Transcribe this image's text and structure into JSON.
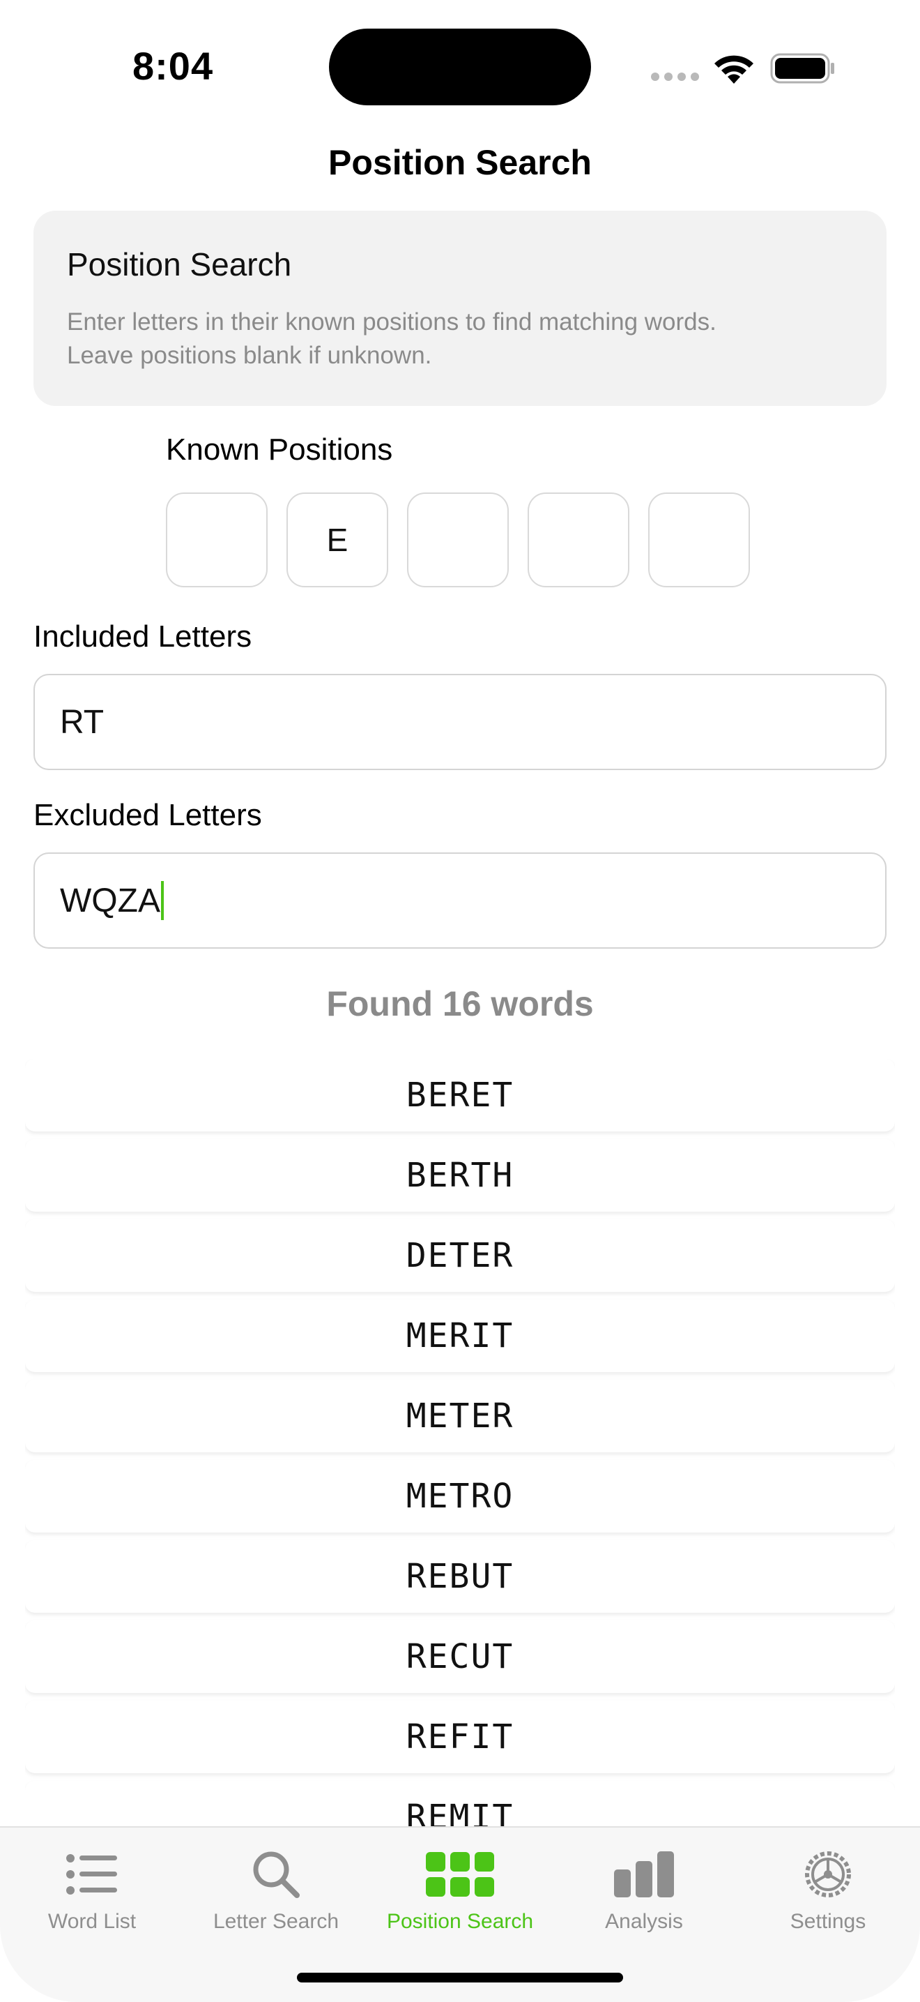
{
  "status_bar": {
    "time": "8:04"
  },
  "nav": {
    "title": "Position Search"
  },
  "info": {
    "title": "Position Search",
    "description": "Enter letters in their known positions to find matching words.\nLeave positions blank if unknown."
  },
  "known_positions": {
    "label": "Known Positions",
    "values": [
      "",
      "E",
      "",
      "",
      ""
    ]
  },
  "included": {
    "label": "Included Letters",
    "value": "RT"
  },
  "excluded": {
    "label": "Excluded Letters",
    "value": "WQZA"
  },
  "results": {
    "summary": "Found 16 words",
    "words": [
      "BERET",
      "BERTH",
      "DETER",
      "MERIT",
      "METER",
      "METRO",
      "REBUT",
      "RECUT",
      "REFIT",
      "REMIT"
    ]
  },
  "tabs": [
    {
      "label": "Word List",
      "icon": "list-icon"
    },
    {
      "label": "Letter Search",
      "icon": "search-icon"
    },
    {
      "label": "Position Search",
      "icon": "grid-icon"
    },
    {
      "label": "Analysis",
      "icon": "bar-chart-icon"
    },
    {
      "label": "Settings",
      "icon": "gear-icon"
    }
  ],
  "colors": {
    "accent": "#4cc417",
    "secondary_text": "#8a8a8a",
    "card_bg": "#f2f2f2"
  }
}
